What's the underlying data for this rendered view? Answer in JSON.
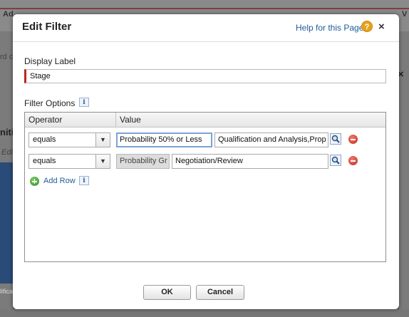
{
  "background": {
    "tab_left": "Ad",
    "tab_right": "V",
    "side_text_1": "rd c",
    "side_text_2": "niti",
    "side_text_3": "Edi",
    "side_text_4": "lifica"
  },
  "dialog": {
    "title": "Edit Filter",
    "help_link": "Help for this Page",
    "help_icon_glyph": "?",
    "close_glyph": "×"
  },
  "display_label": {
    "label": "Display Label",
    "value": "Stage"
  },
  "filter_options": {
    "label": "Filter Options",
    "info_glyph": "i",
    "columns": [
      "Operator",
      "Value"
    ],
    "rows": [
      {
        "operator": "equals",
        "value_a": "Probability 50% or Less",
        "value_b": "Qualification and Analysis,Prop"
      },
      {
        "operator": "equals",
        "value_a": "Probability Gr",
        "value_b": "Negotiation/Review"
      }
    ],
    "add_row_label": "Add Row"
  },
  "buttons": {
    "ok": "OK",
    "cancel": "Cancel"
  },
  "colors": {
    "required_bar": "#b9291c",
    "link": "#1f5c9a",
    "help_icon": "#e8a21a"
  }
}
